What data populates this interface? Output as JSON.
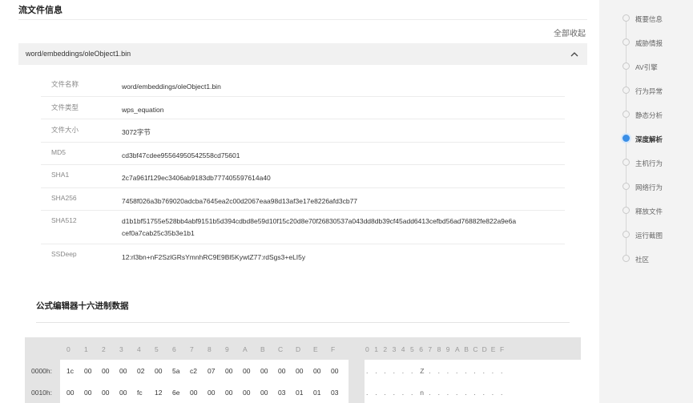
{
  "section": {
    "title": "流文件信息",
    "collapse_all": "全部收起"
  },
  "file": {
    "path": "word/embeddings/oleObject1.bin"
  },
  "info_rows": [
    {
      "key": "文件名称",
      "value": "word/embeddings/oleObject1.bin"
    },
    {
      "key": "文件类型",
      "value": "wps_equation"
    },
    {
      "key": "文件大小",
      "value": "3072字节"
    },
    {
      "key": "MD5",
      "value": "cd3bf47cdee95564950542558cd75601"
    },
    {
      "key": "SHA1",
      "value": "2c7a961f129ec3406ab9183db777405597614a40"
    },
    {
      "key": "SHA256",
      "value": "7458f026a3b769020adcba7645ea2c00d2067eaa98d13af3e17e8226afd3cb77"
    },
    {
      "key": "SHA512",
      "value_line1": "d1b1bf51755e528bb4abf9151b5d394cdbd8e59d10f15c20d8e70f26830537a043dd8db39cf45add6413cefbd56ad76882fe822a9e6a",
      "value_line2": "cef0a7cab25c35b3e1b1"
    },
    {
      "key": "SSDeep",
      "value": "12:rl3bn+nF2SzlGRsYmnhRC9E9Bl5KywtZ77:rdSgs3+eLI5y"
    }
  ],
  "hex": {
    "title": "公式编辑器十六进制数据",
    "col_headers": [
      "0",
      "1",
      "2",
      "3",
      "4",
      "5",
      "6",
      "7",
      "8",
      "9",
      "A",
      "B",
      "C",
      "D",
      "E",
      "F"
    ],
    "rows": [
      {
        "addr": "0000h:",
        "bytes": [
          "1c",
          "00",
          "00",
          "00",
          "02",
          "00",
          "5a",
          "c2",
          "07",
          "00",
          "00",
          "00",
          "00",
          "00",
          "00",
          "00"
        ],
        "ascii": [
          ".",
          ".",
          ".",
          ".",
          ".",
          ".",
          "Z",
          ".",
          ".",
          ".",
          ".",
          ".",
          ".",
          ".",
          ".",
          "."
        ]
      },
      {
        "addr": "0010h:",
        "bytes": [
          "00",
          "00",
          "00",
          "00",
          "fc",
          "12",
          "6e",
          "00",
          "00",
          "00",
          "00",
          "00",
          "03",
          "01",
          "01",
          "03"
        ],
        "ascii": [
          ".",
          ".",
          ".",
          ".",
          ".",
          ".",
          "n",
          ".",
          ".",
          ".",
          ".",
          ".",
          ".",
          ".",
          ".",
          "."
        ]
      }
    ]
  },
  "nav": {
    "active_index": 5,
    "accent_color": "#3a8ee6",
    "items": [
      "概要信息",
      "威胁情报",
      "AV引擎",
      "行为异常",
      "静态分析",
      "深度解析",
      "主机行为",
      "网络行为",
      "释放文件",
      "运行截图",
      "社区"
    ]
  }
}
